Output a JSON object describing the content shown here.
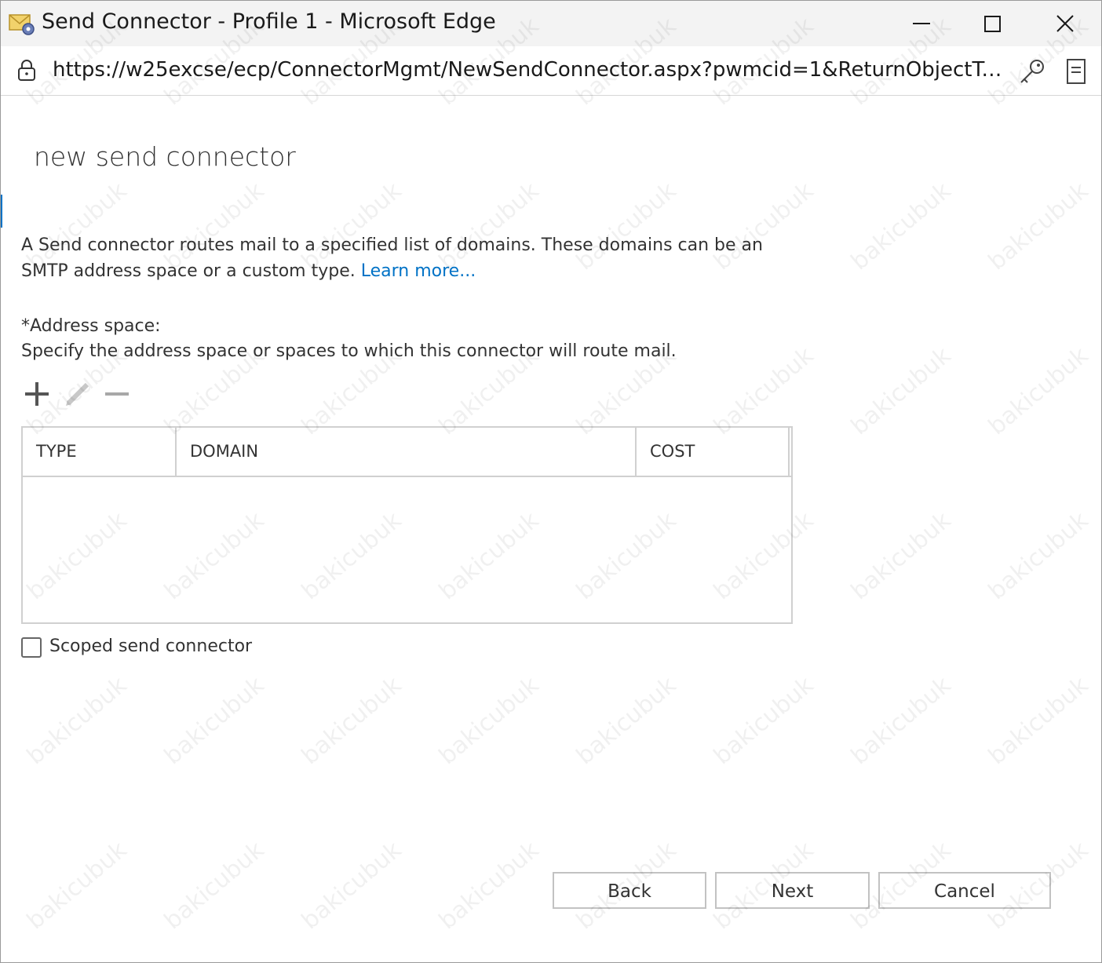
{
  "window": {
    "title": "Send Connector - Profile 1 - Microsoft Edge",
    "controls": [
      "minimize",
      "maximize",
      "close"
    ]
  },
  "addressbar": {
    "url": "https://w25excse/ecp/ConnectorMgmt/NewSendConnector.aspx?pwmcid=1&ReturnObjectType..."
  },
  "page": {
    "title": "new send connector",
    "description": "A Send connector routes mail to a specified list of domains. These domains can be an SMTP address space or a custom type.",
    "learn_more": "Learn more...",
    "address_space_label": "*Address space:",
    "address_space_hint": "Specify the address space or spaces to which this connector will route mail.",
    "toolbar": {
      "add": "add-icon",
      "edit": "edit-icon",
      "remove": "remove-icon"
    },
    "table": {
      "columns": [
        "TYPE",
        "DOMAIN",
        "COST"
      ],
      "rows": []
    },
    "scoped": {
      "label": "Scoped send connector",
      "checked": false
    },
    "buttons": {
      "back": "Back",
      "next": "Next",
      "cancel": "Cancel"
    }
  },
  "watermark": "bakicubuk",
  "colors": {
    "link": "#0072c6",
    "accent": "#0072c6",
    "border": "#d0d0d0"
  }
}
